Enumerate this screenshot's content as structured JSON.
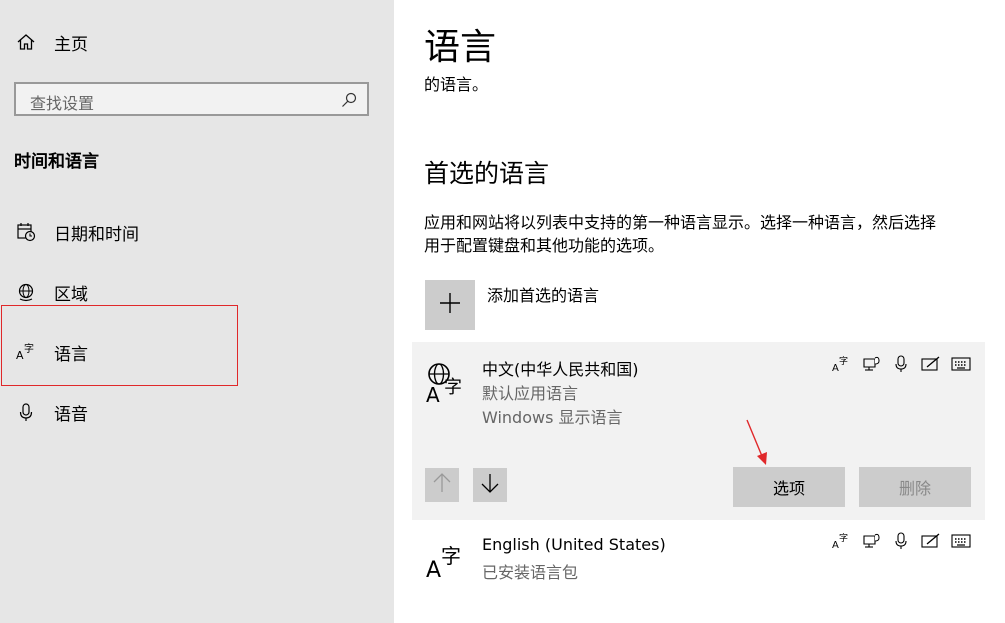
{
  "sidebar": {
    "home_label": "主页",
    "search_placeholder": "查找设置",
    "section_title": "时间和语言",
    "items": [
      {
        "label": "日期和时间",
        "icon": "calendar-clock-icon"
      },
      {
        "label": "区域",
        "icon": "globe-region-icon"
      },
      {
        "label": "语言",
        "icon": "language-icon",
        "selected": true
      },
      {
        "label": "语音",
        "icon": "microphone-icon"
      }
    ]
  },
  "main": {
    "title": "语言",
    "subtitle": "的语言。",
    "preferred_heading": "首选的语言",
    "description_line1": "应用和网站将以列表中支持的第一种语言显示。选择一种语言，然后选择",
    "description_line2": "用于配置键盘和其他功能的选项。",
    "add_label": "添加首选的语言",
    "languages": [
      {
        "name": "中文(中华人民共和国)",
        "line1": "默认应用语言",
        "line2": "Windows 显示语言",
        "options_label": "选项",
        "remove_label": "删除"
      },
      {
        "name": "English (United States)",
        "line1": "已安装语言包"
      }
    ]
  },
  "colors": {
    "sidebar_bg": "#e6e6e6",
    "card_bg": "#f2f2f2",
    "button_bg": "#cccccc",
    "annotation_red": "#e0282a"
  }
}
